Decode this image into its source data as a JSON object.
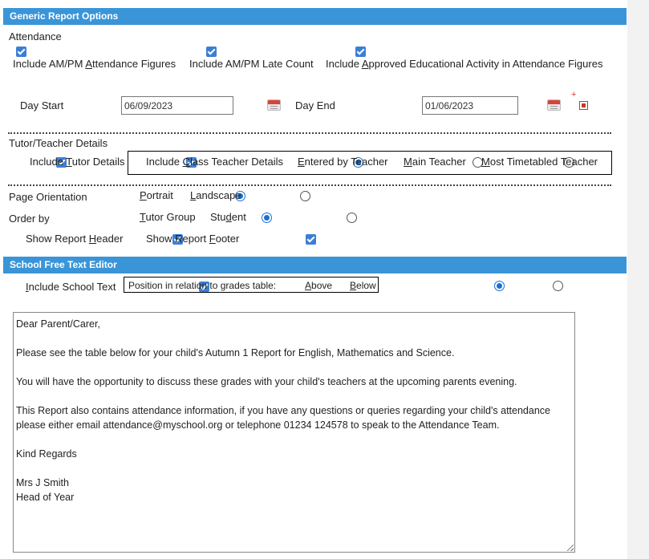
{
  "generic": {
    "header": "Generic Report Options",
    "attendance_label": "Attendance",
    "attendance_options": [
      {
        "pre": "Include AM/PM ",
        "u": "A",
        "post": "ttendance Figures",
        "checked": true
      },
      {
        "pre": "Include AM/PM Late Count",
        "u": "",
        "post": "",
        "checked": true
      },
      {
        "pre": "Include ",
        "u": "A",
        "post": "pproved Educational Activity in Attendance Figures",
        "checked": true
      }
    ],
    "day_start_label": "Day Start",
    "day_start_value": "06/09/2023",
    "day_end_label": "Day End",
    "day_end_value": "01/06/2023",
    "plus": "+",
    "tutor_section_label": "Tutor/Teacher Details",
    "tutor": {
      "pre": "Include ",
      "u": "T",
      "post": "utor Details"
    },
    "class_teacher": {
      "pre": "Include ",
      "u": "C",
      "post": "lass Teacher Details"
    },
    "teacher_source": [
      {
        "u": "E",
        "post": "ntered by Teacher",
        "selected": true
      },
      {
        "u": "M",
        "post": "ain Teacher",
        "selected": false
      },
      {
        "u": "M",
        "post": "ost Timetabled Teacher",
        "selected": false
      }
    ],
    "orientation_label": "Page Orientation",
    "orientation": [
      {
        "u": "P",
        "post": "ortrait",
        "selected": true
      },
      {
        "u": "L",
        "post": "andscape",
        "selected": false
      }
    ],
    "order_label": "Order by",
    "order": [
      {
        "u": "T",
        "post": "utor Group",
        "selected": true
      },
      {
        "pre": "Stu",
        "u": "d",
        "post": "ent",
        "selected": false
      }
    ],
    "show_header": {
      "pre": "Show Report ",
      "u": "H",
      "post": "eader"
    },
    "show_footer": {
      "pre": "Show Report ",
      "u": "F",
      "post": "ooter"
    }
  },
  "free_text": {
    "header": "School Free Text Editor",
    "include_school_text": {
      "u": "I",
      "post": "nclude School Text"
    },
    "position_label": "Position in relation to grades table:",
    "position": [
      {
        "u": "A",
        "post": "bove",
        "selected": true
      },
      {
        "u": "B",
        "post": "elow",
        "selected": false
      }
    ],
    "lines": [
      "Dear Parent/Carer,",
      "",
      "Please see the table below for your child's Autumn 1 Report for English, Mathematics and Science.",
      "",
      "You will have the opportunity to discuss these grades with your child's teachers at the upcoming parents evening.",
      "",
      "This Report also contains attendance information, if you have any questions or queries regarding your child's attendance",
      "please either email attendance@myschool.org or telephone 01234 124578 to speak to the Attendance Team.",
      "",
      "Kind Regards",
      "",
      "Mrs J Smith",
      "Head of Year"
    ]
  }
}
